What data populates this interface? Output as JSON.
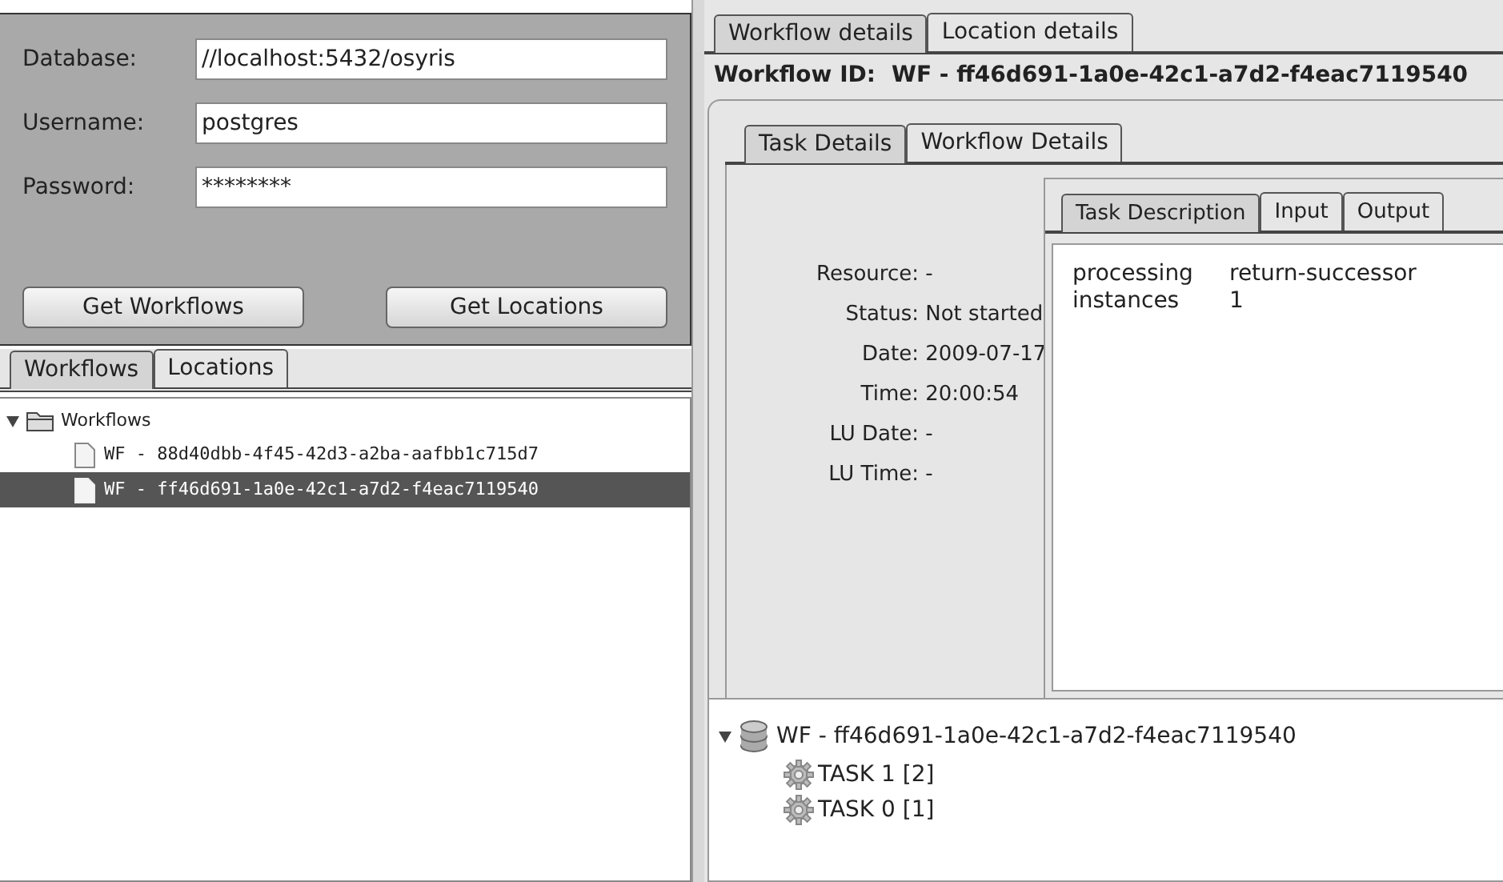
{
  "login": {
    "fields": [
      {
        "label": "Database:",
        "value": "//localhost:5432/osyris"
      },
      {
        "label": "Username:",
        "value": "postgres"
      },
      {
        "label": "Password:",
        "value": "********"
      }
    ],
    "buttons": [
      "Get Workflows",
      "Get Locations"
    ]
  },
  "left_tabs": [
    {
      "label": "Workflows",
      "selected": true
    },
    {
      "label": "Locations",
      "selected": false
    }
  ],
  "workflow_tree": {
    "label": "Workflows",
    "expanded": true,
    "children": [
      {
        "label": "WF - 88d40dbb-4f45-42d3-a2ba-aafbb1c715d7",
        "selected": false
      },
      {
        "label": "WF - ff46d691-1a0e-42c1-a7d2-f4eac7119540",
        "selected": true
      }
    ]
  },
  "right_tabs": [
    {
      "label": "Workflow details",
      "selected": true
    },
    {
      "label": "Location details",
      "selected": false
    }
  ],
  "workflow_id": {
    "label": "Workflow ID:",
    "value": "WF - ff46d691-1a0e-42c1-a7d2-f4eac7119540"
  },
  "detail_tabs": [
    {
      "label": "Task Details",
      "selected": true
    },
    {
      "label": "Workflow Details",
      "selected": false
    }
  ],
  "task_fields": [
    "Resource: -",
    "Status: Not started",
    "Date: 2009-07-17",
    "Time: 20:00:54",
    "LU Date: -",
    "LU Time: -"
  ],
  "task_tabs": [
    {
      "label": "Task Description",
      "selected": true
    },
    {
      "label": "Input",
      "selected": false
    },
    {
      "label": "Output",
      "selected": false
    }
  ],
  "task_description": [
    {
      "key": "processing",
      "value": "return-successor"
    },
    {
      "key": "instances",
      "value": "1"
    }
  ],
  "task_tree": {
    "label": "WF - ff46d691-1a0e-42c1-a7d2-f4eac7119540",
    "expanded": true,
    "children": [
      {
        "label": "TASK 1 [2]"
      },
      {
        "label": "TASK 0 [1]"
      }
    ]
  }
}
